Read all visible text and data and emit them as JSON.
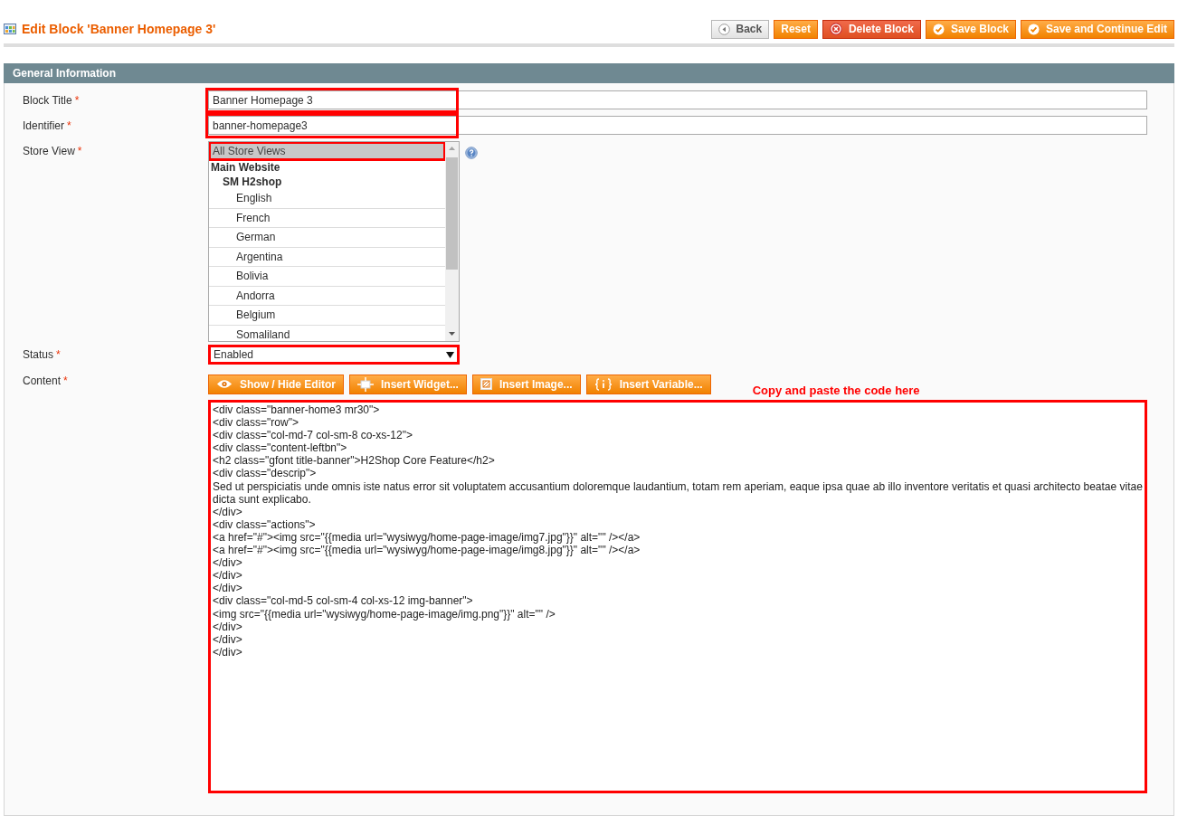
{
  "page_title": "Edit Block 'Banner Homepage 3'",
  "actions": [
    {
      "kind": "back",
      "label": "Back"
    },
    {
      "kind": "reset",
      "label": "Reset"
    },
    {
      "kind": "delete",
      "label": "Delete Block"
    },
    {
      "kind": "save",
      "label": "Save Block"
    },
    {
      "kind": "save",
      "label": "Save and Continue Edit"
    }
  ],
  "section": {
    "title": "General Information",
    "fields": [
      {
        "kind": "text",
        "label": "Block Title",
        "required_mark": "*",
        "value": "Banner Homepage 3",
        "highlighted": true
      },
      {
        "kind": "text",
        "label": "Identifier",
        "required_mark": "*",
        "value": "banner-homepage3",
        "highlighted": true
      },
      {
        "kind": "multiselect",
        "label": "Store View",
        "required_mark": "*",
        "highlighted": true,
        "options": [
          {
            "kind": "option",
            "label": "All Store Views",
            "selected": true
          },
          {
            "kind": "group",
            "label": "Main Website",
            "children": [
              {
                "kind": "group",
                "label": "SM H2shop",
                "children": [
                  {
                    "kind": "option",
                    "label": "English",
                    "selected": false
                  },
                  {
                    "kind": "option",
                    "label": "French",
                    "selected": false
                  },
                  {
                    "kind": "option",
                    "label": "German",
                    "selected": false
                  },
                  {
                    "kind": "option",
                    "label": "Argentina",
                    "selected": false
                  },
                  {
                    "kind": "option",
                    "label": "Bolivia",
                    "selected": false
                  },
                  {
                    "kind": "option",
                    "label": "Andorra",
                    "selected": false
                  },
                  {
                    "kind": "option",
                    "label": "Belgium",
                    "selected": false
                  },
                  {
                    "kind": "option",
                    "label": "Somaliland",
                    "selected": false
                  }
                ]
              }
            ]
          }
        ]
      },
      {
        "kind": "select",
        "label": "Status",
        "required_mark": "*",
        "value": "Enabled",
        "highlighted": true
      },
      {
        "kind": "editor",
        "label": "Content",
        "required_mark": "*",
        "highlighted": true,
        "tools": [
          {
            "kind": "eye",
            "label": "Show / Hide Editor"
          },
          {
            "kind": "widget",
            "label": "Insert Widget..."
          },
          {
            "kind": "image",
            "label": "Insert Image..."
          },
          {
            "kind": "variable",
            "label": "Insert Variable..."
          }
        ],
        "note": "Copy and paste the code here",
        "value": "<div class=\"banner-home3 mr30\">\n<div class=\"row\">\n<div class=\"col-md-7 col-sm-8 co-xs-12\">\n<div class=\"content-leftbn\">\n<h2 class=\"gfont title-banner\">H2Shop Core Feature</h2>\n<div class=\"descrip\">\nSed ut perspiciatis unde omnis iste natus error sit voluptatem accusantium doloremque laudantium, totam rem aperiam, eaque ipsa quae ab illo inventore veritatis et quasi architecto beatae vitae dicta sunt explicabo.\n</div>\n<div class=\"actions\">\n<a href=\"#\"><img src=\"{{media url=\"wysiwyg/home-page-image/img7.jpg\"}}\" alt=\"\" /></a>\n<a href=\"#\"><img src=\"{{media url=\"wysiwyg/home-page-image/img8.jpg\"}}\" alt=\"\" /></a>\n</div>\n</div>\n</div>\n<div class=\"col-md-5 col-sm-4 col-xs-12 img-banner\">\n<img src=\"{{media url=\"wysiwyg/home-page-image/img.png\"}}\" alt=\"\" />\n</div>\n</div>\n</div>"
      }
    ]
  }
}
